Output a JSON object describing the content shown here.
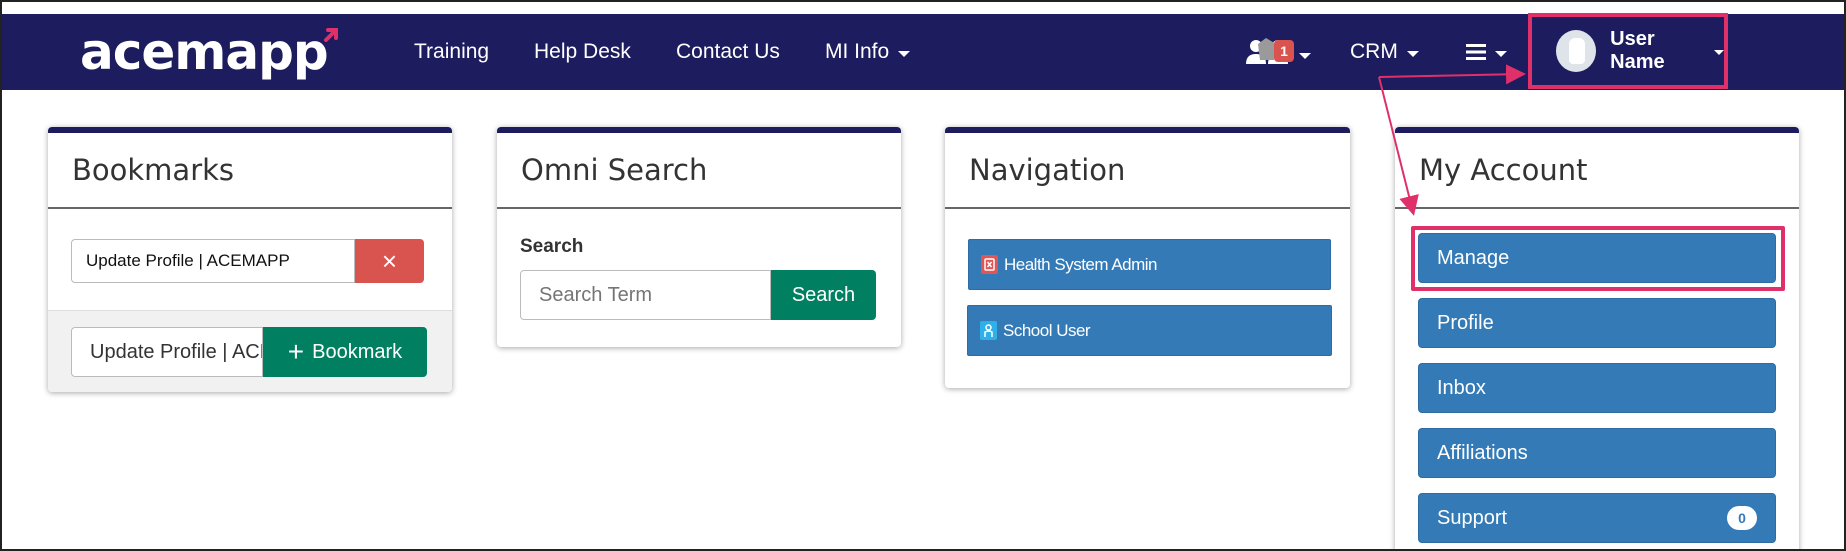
{
  "navbar": {
    "logo": "acemapp",
    "links": [
      "Training",
      "Help Desk",
      "Contact Us",
      "MI Info"
    ],
    "notification_count": "1",
    "crm_label": "CRM",
    "user_name": "User Name"
  },
  "bookmarks": {
    "title": "Bookmarks",
    "existing_bookmark": "Update Profile | ACEMAPP",
    "remove_icon": "×",
    "new_bookmark_value": "Update Profile | ACEMAPP",
    "add_button": "Bookmark",
    "add_icon": "+"
  },
  "omni_search": {
    "title": "Omni Search",
    "search_label": "Search",
    "placeholder": "Search Term",
    "button": "Search"
  },
  "navigation": {
    "title": "Navigation",
    "items": [
      {
        "label": "Health System Admin",
        "icon": "health-system-icon",
        "color": "#e05555"
      },
      {
        "label": "School User",
        "icon": "school-user-icon",
        "color": "#2fb0e8"
      }
    ]
  },
  "my_account": {
    "title": "My Account",
    "items": [
      {
        "label": "Manage"
      },
      {
        "label": "Profile"
      },
      {
        "label": "Inbox"
      },
      {
        "label": "Affiliations"
      },
      {
        "label": "Support",
        "count": "0"
      }
    ]
  },
  "colors": {
    "navbar": "#1c1c5e",
    "highlight": "#e0306a",
    "primary": "#337ab7",
    "success": "#008060",
    "danger": "#d9534f"
  }
}
